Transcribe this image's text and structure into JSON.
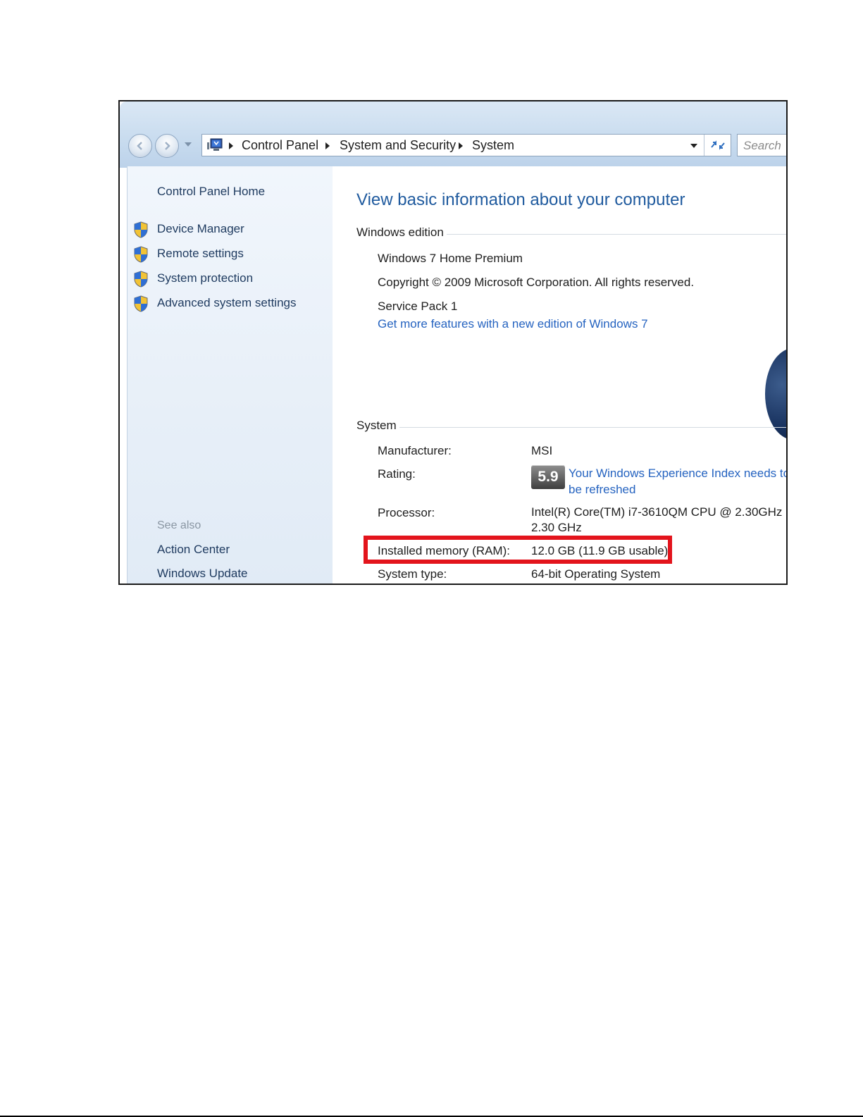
{
  "address_bar": {
    "crumbs": [
      "Control Panel",
      "System and Security",
      "System"
    ]
  },
  "search": {
    "placeholder": "Search"
  },
  "sidebar": {
    "home": "Control Panel Home",
    "tasks": [
      "Device Manager",
      "Remote settings",
      "System protection",
      "Advanced system settings"
    ],
    "see_also_title": "See also",
    "see_also": [
      "Action Center",
      "Windows Update"
    ]
  },
  "main": {
    "title": "View basic information about your computer",
    "windows_edition": {
      "heading": "Windows edition",
      "edition": "Windows 7 Home Premium",
      "copyright": "Copyright © 2009 Microsoft Corporation.  All rights reserved.",
      "service_pack": "Service Pack 1",
      "upgrade_link": "Get more features with a new edition of Windows 7"
    },
    "system": {
      "heading": "System",
      "manufacturer_label": "Manufacturer:",
      "manufacturer_value": "MSI",
      "rating_label": "Rating:",
      "rating_score": "5.9",
      "rating_link_line1": "Your Windows Experience Index needs to",
      "rating_link_line2": "be refreshed",
      "processor_label": "Processor:",
      "processor_line1": "Intel(R) Core(TM) i7-3610QM CPU @ 2.30GHz",
      "processor_line2": "2.30 GHz",
      "memory_label": "Installed memory (RAM):",
      "memory_value": "12.0 GB (11.9 GB usable)",
      "type_label": "System type:",
      "type_value": "64-bit Operating System"
    }
  },
  "colors": {
    "highlight": "#e3141c",
    "link": "#2563c0",
    "title": "#1f5a9e"
  }
}
